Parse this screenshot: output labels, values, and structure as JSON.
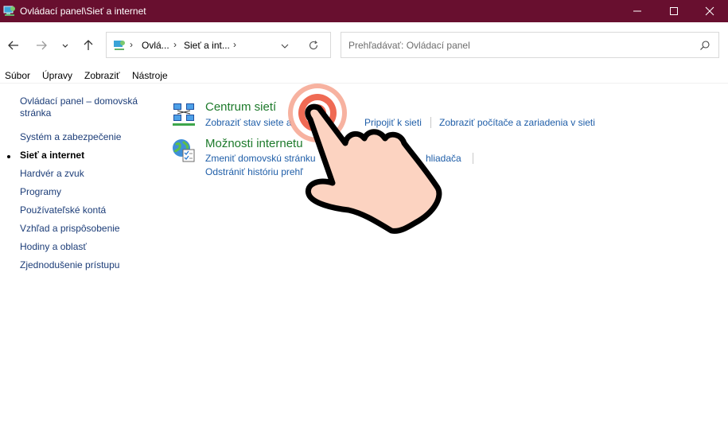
{
  "window": {
    "title": "Ovládací panel\\Sieť a internet",
    "accent": "#680f2f"
  },
  "nav": {
    "crumbs": [
      "Ovlá...",
      "Sieť a int..."
    ],
    "search_placeholder": "Prehľadávať: Ovládací panel"
  },
  "menu": [
    "Súbor",
    "Úpravy",
    "Zobraziť",
    "Nástroje"
  ],
  "sidebar": {
    "items": [
      {
        "label": "Ovládací panel – domovská"
      },
      {
        "label": "stránka"
      },
      {
        "label": "Systém a zabezpečenie"
      },
      {
        "label": "Sieť a internet"
      },
      {
        "label": "Hardvér a zvuk"
      },
      {
        "label": "Programy"
      },
      {
        "label": "Používateľské kontá"
      },
      {
        "label": "Vzhľad a prispôsobenie"
      },
      {
        "label": "Hodiny a oblasť"
      },
      {
        "label": "Zjednodušenie prístupu"
      }
    ]
  },
  "categories": [
    {
      "title": "Centrum sietí",
      "icon": "network-center-icon",
      "links": [
        "Zobraziť stav siete a",
        "Pripojiť k sieti",
        "Zobraziť počítače a zariadenia v sieti"
      ]
    },
    {
      "title": "Možnosti internetu",
      "icon": "internet-options-icon",
      "links": [
        "Zmeniť domovskú stránku",
        "hliadača",
        "Odstrániť históriu prehľ"
      ]
    }
  ],
  "overlay": {
    "type": "tap-gesture",
    "color": "#f26b52"
  }
}
